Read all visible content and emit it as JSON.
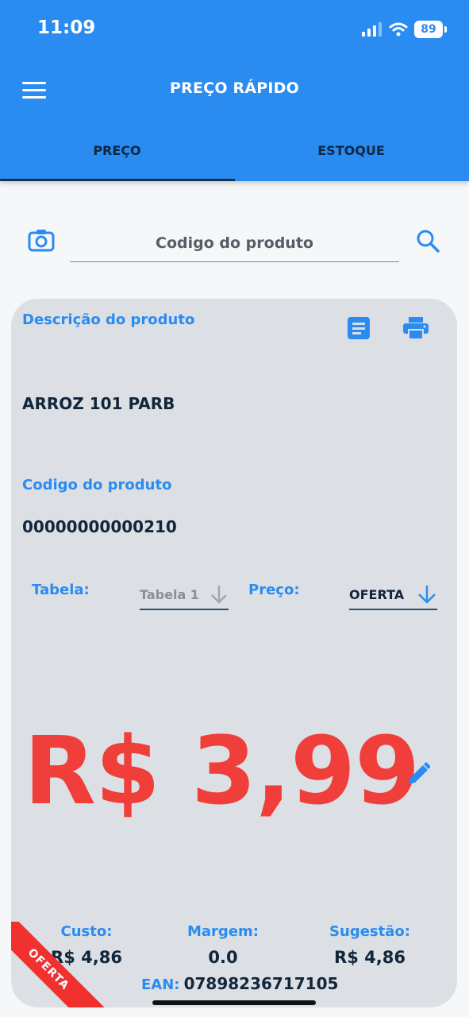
{
  "status_bar": {
    "time": "11:09",
    "battery": "89"
  },
  "app_bar": {
    "title": "PREÇO RÁPIDO"
  },
  "tabs": [
    {
      "label": "PREÇO",
      "active": true
    },
    {
      "label": "ESTOQUE",
      "active": false
    }
  ],
  "search": {
    "placeholder": "Codigo do produto",
    "value": ""
  },
  "product": {
    "description_label": "Descrição do produto",
    "description": "ARROZ 101 PARB",
    "code_label": "Codigo do produto",
    "code": "00000000000210"
  },
  "selectors": {
    "table_label": "Tabela:",
    "table_value": "Tabela 1",
    "price_label": "Preço:",
    "price_value": "OFERTA"
  },
  "price_display": "R$ 3,99",
  "summary": {
    "cost_label": "Custo:",
    "cost_value": "R$ 4,86",
    "margin_label": "Margem:",
    "margin_value": "0.0",
    "suggestion_label": "Sugestão:",
    "suggestion_value": "R$ 4,86",
    "ean_label": "EAN:",
    "ean_value": "07898236717105"
  },
  "ribbon": "OFERTA",
  "colors": {
    "primary": "#2a8cf0",
    "dark": "#12263b",
    "price_red": "#f03e3a",
    "card_bg": "#dcdfe4"
  }
}
